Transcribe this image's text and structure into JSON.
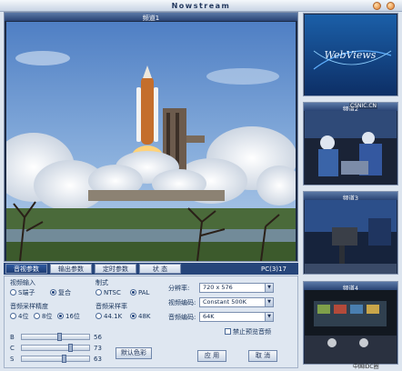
{
  "window": {
    "title": "Nowstream"
  },
  "main_video": {
    "label": "频道1"
  },
  "tabs": [
    {
      "label": "音视参数",
      "active": true
    },
    {
      "label": "输出参数",
      "active": false
    },
    {
      "label": "定时参数",
      "active": false
    },
    {
      "label": "状 态",
      "active": false
    }
  ],
  "fps": "PC(3)17",
  "video_input": {
    "label": "视频输入",
    "options": [
      {
        "label": "S端子",
        "checked": false
      },
      {
        "label": "复合",
        "checked": true
      }
    ]
  },
  "format": {
    "label": "制式",
    "options": [
      {
        "label": "NTSC",
        "checked": false
      },
      {
        "label": "PAL",
        "checked": true
      }
    ]
  },
  "audio_bits": {
    "label": "音频采样精度",
    "options": [
      {
        "label": "4位",
        "checked": false
      },
      {
        "label": "8位",
        "checked": false
      },
      {
        "label": "16位",
        "checked": true
      }
    ]
  },
  "audio_rate": {
    "label": "音频采样率",
    "options": [
      {
        "label": "44.1K",
        "checked": false
      },
      {
        "label": "48K",
        "checked": true
      }
    ]
  },
  "sliders": [
    {
      "label": "B",
      "value": "56",
      "level": 0.56
    },
    {
      "label": "C",
      "value": "73",
      "level": 0.73
    },
    {
      "label": "S",
      "value": "63",
      "level": 0.63
    }
  ],
  "default_color_button": "默认色彩",
  "resolution": {
    "label": "分辨率:",
    "value": "720 x 576"
  },
  "video_codec": {
    "label": "视频编码:",
    "value": "Constant 500K"
  },
  "audio_codec": {
    "label": "音频编码:",
    "value": "64K"
  },
  "disable_preview_audio": {
    "label": "禁止预览音频",
    "checked": false
  },
  "apply_button": "应 用",
  "cancel_button": "取 消",
  "thumbnails": [
    {
      "label": "",
      "logo": "WebViews"
    },
    {
      "label": "频道2"
    },
    {
      "label": "频道3"
    },
    {
      "label": "频道4"
    }
  ],
  "overlay_text": "CSNIC.CN",
  "watermark": "中国IDC圈"
}
